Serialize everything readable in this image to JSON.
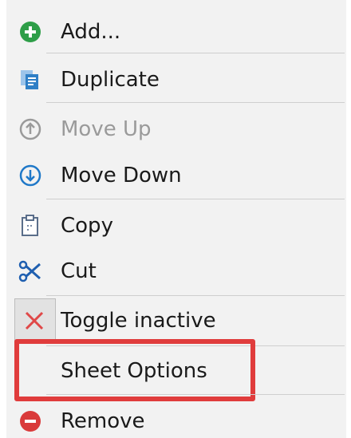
{
  "menu": {
    "items": [
      {
        "label": "Add...",
        "icon": "add-icon",
        "enabled": true
      },
      {
        "label": "Duplicate",
        "icon": "duplicate-icon",
        "enabled": true
      },
      {
        "label": "Move Up",
        "icon": "move-up-icon",
        "enabled": false
      },
      {
        "label": "Move Down",
        "icon": "move-down-icon",
        "enabled": true
      },
      {
        "label": "Copy",
        "icon": "copy-icon",
        "enabled": true
      },
      {
        "label": "Cut",
        "icon": "cut-icon",
        "enabled": true
      },
      {
        "label": "Toggle inactive",
        "icon": "toggle-inactive-icon",
        "enabled": true
      },
      {
        "label": "Sheet Options",
        "icon": "",
        "enabled": true
      },
      {
        "label": "Remove",
        "icon": "remove-icon",
        "enabled": true
      }
    ]
  },
  "colors": {
    "add_green": "#2e9e48",
    "duplicate_blue": "#2f7fc6",
    "disabled_gray": "#9a9a9a",
    "move_down_blue": "#1f78c8",
    "cut_blue": "#1f5fb0",
    "toggle_red": "#e04848",
    "remove_red": "#d93a3a",
    "highlight_red": "#e03c3c"
  }
}
